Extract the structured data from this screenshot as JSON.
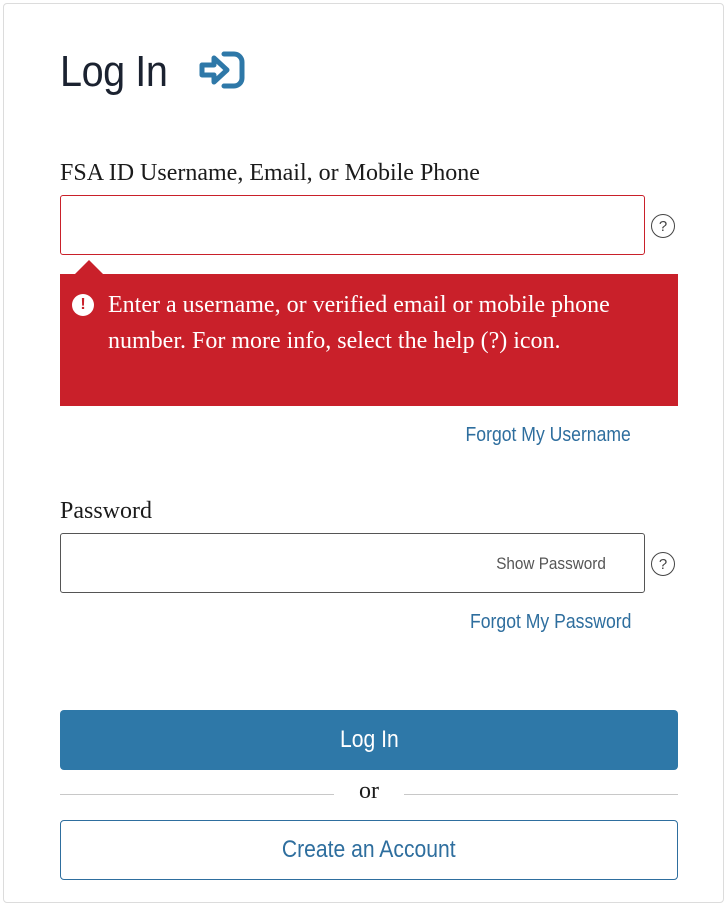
{
  "header": {
    "title": "Log In",
    "icon": "login-arrow-icon"
  },
  "username": {
    "label": "FSA ID Username, Email, or Mobile Phone",
    "value": "",
    "help_symbol": "?",
    "error_message": "Enter a username, or verified email or mobile phone number. For more info, select the help (?) icon.",
    "error_icon_symbol": "!",
    "forgot_link": "Forgot My Username"
  },
  "password": {
    "label": "Password",
    "value": "",
    "show_toggle": "Show Password",
    "help_symbol": "?",
    "forgot_link": "Forgot My Password"
  },
  "actions": {
    "login_label": "Log In",
    "or_label": "or",
    "create_label": "Create an Account"
  },
  "colors": {
    "primary": "#2e78a8",
    "link": "#2e6e9e",
    "error": "#c9202a"
  }
}
